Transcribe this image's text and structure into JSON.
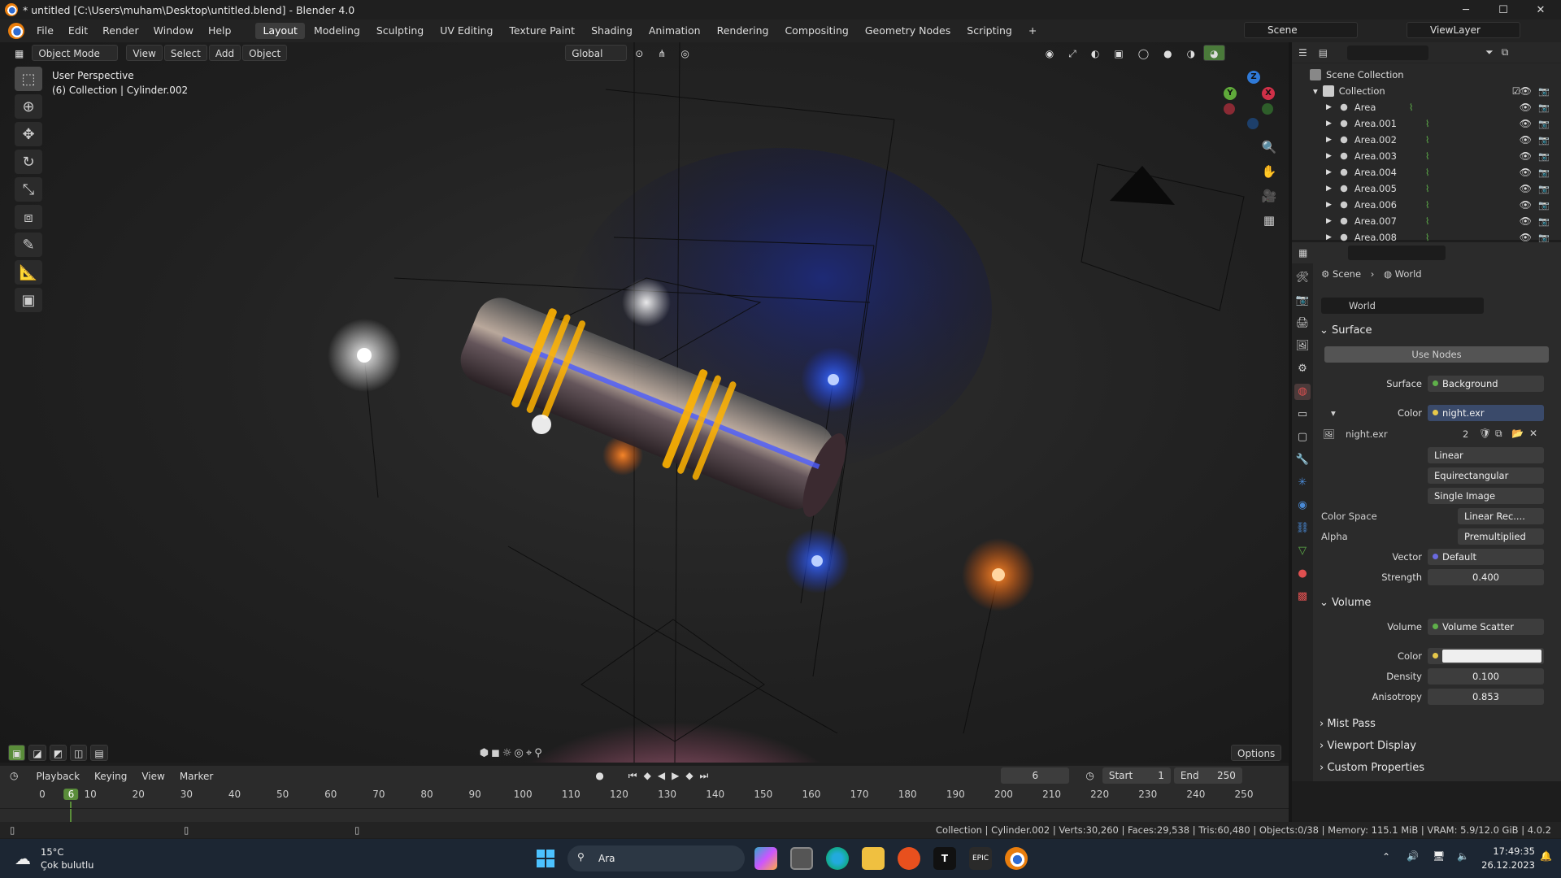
{
  "title_bar": {
    "title": "* untitled [C:\\Users\\muham\\Desktop\\untitled.blend] - Blender 4.0",
    "minimize": "─",
    "maximize": "☐",
    "close": "✕"
  },
  "menubar": {
    "menus": [
      "File",
      "Edit",
      "Render",
      "Window",
      "Help"
    ],
    "workspaces": [
      "Layout",
      "Modeling",
      "Sculpting",
      "UV Editing",
      "Texture Paint",
      "Shading",
      "Animation",
      "Rendering",
      "Compositing",
      "Geometry Nodes",
      "Scripting"
    ],
    "add_tab": "+",
    "scene": "Scene",
    "view_layer": "ViewLayer"
  },
  "viewport_header": {
    "mode": "Object Mode",
    "view": "View",
    "select": "Select",
    "add": "Add",
    "object": "Object",
    "transform": "Global"
  },
  "viewport_overlay": {
    "line1": "User Perspective",
    "line2": "(6) Collection | Cylinder.002"
  },
  "gizmo": {
    "x": "X",
    "y": "Y",
    "z": "Z"
  },
  "viewport_bottom": {
    "options": "Options"
  },
  "outliner": {
    "scene_collection": "Scene Collection",
    "collection": "Collection",
    "items": [
      "Area",
      "Area.001",
      "Area.002",
      "Area.003",
      "Area.004",
      "Area.005",
      "Area.006",
      "Area.007",
      "Area.008"
    ]
  },
  "properties": {
    "breadcrumb_scene": "Scene",
    "breadcrumb_world": "World",
    "world_name": "World",
    "surface_panel": "Surface",
    "use_nodes": "Use Nodes",
    "surface_label": "Surface",
    "surface_value": "Background",
    "color_label": "Color",
    "color_value": "night.exr",
    "image_name": "night.exr",
    "image_users": "2",
    "interpolation": "Linear",
    "projection": "Equirectangular",
    "source": "Single Image",
    "color_space_label": "Color Space",
    "color_space_value": "Linear Rec....",
    "alpha_label": "Alpha",
    "alpha_value": "Premultiplied",
    "vector_label": "Vector",
    "vector_value": "Default",
    "strength_label": "Strength",
    "strength_value": "0.400",
    "volume_panel": "Volume",
    "volume_label": "Volume",
    "volume_value": "Volume Scatter",
    "vcolor_label": "Color",
    "density_label": "Density",
    "density_value": "0.100",
    "anisotropy_label": "Anisotropy",
    "anisotropy_value": "0.853",
    "mist_pass": "Mist Pass",
    "viewport_display": "Viewport Display",
    "custom_properties": "Custom Properties"
  },
  "timeline": {
    "playback": "Playback",
    "keying": "Keying",
    "view": "View",
    "marker": "Marker",
    "current_frame": "6",
    "start_label": "Start",
    "start_value": "1",
    "end_label": "End",
    "end_value": "250",
    "ruler": [
      "0",
      "6",
      "10",
      "20",
      "30",
      "40",
      "50",
      "60",
      "70",
      "80",
      "90",
      "100",
      "110",
      "120",
      "130",
      "140",
      "150",
      "160",
      "170",
      "180",
      "190",
      "200",
      "210",
      "220",
      "230",
      "240",
      "250"
    ]
  },
  "status_bar": {
    "stats": "Collection | Cylinder.002 | Verts:30,260 | Faces:29,538 | Tris:60,480 | Objects:0/38 | Memory: 115.1 MiB | VRAM: 5.9/12.0 GiB | 4.0.2"
  },
  "taskbar": {
    "weather_temp": "15°C",
    "weather_desc": "Çok bulutlu",
    "search": "Ara",
    "time": "17:49:35",
    "date": "26.12.2023"
  }
}
